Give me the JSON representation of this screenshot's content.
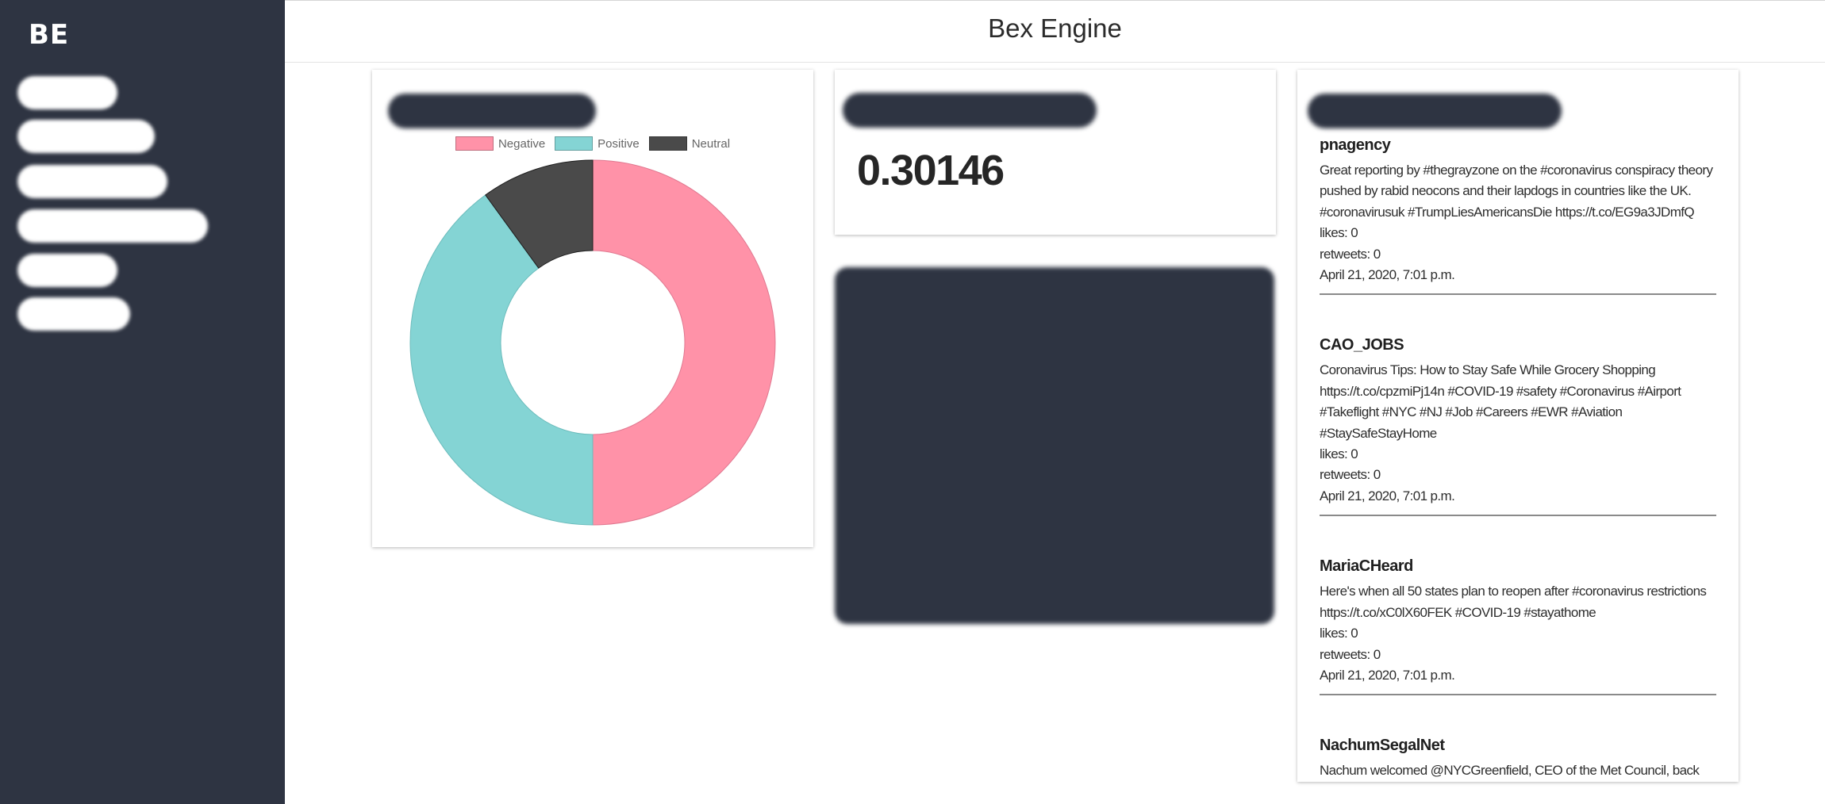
{
  "app": {
    "brand": "BE",
    "title": "Bex Engine"
  },
  "colors": {
    "sidebar": "#2e3442",
    "negative": "#ff92a8",
    "positive": "#84d4d4",
    "neutral": "#4a4a4a"
  },
  "score": {
    "value": "0.30146"
  },
  "chart_data": {
    "type": "pie",
    "variant": "doughnut",
    "categories": [
      "Negative",
      "Positive",
      "Neutral"
    ],
    "values": [
      50,
      40,
      10
    ],
    "colors": [
      "#ff92a8",
      "#84d4d4",
      "#4a4a4a"
    ],
    "legend_position": "top"
  },
  "tweets": {
    "items": [
      {
        "user": "pnagency",
        "text": "Great reporting by #thegrayzone on the #coronavirus conspiracy theory pushed by rabid neocons and their lapdogs in countries like the UK. #coronavirusuk #TrumpLiesAmericansDie https://t.co/EG9a3JDmfQ",
        "likes": "likes: 0",
        "retweets": "retweets: 0",
        "date": "April 21, 2020, 7:01 p.m."
      },
      {
        "user": "CAO_JOBS",
        "text": "Coronavirus Tips: How to Stay Safe While Grocery Shopping https://t.co/cpzmiPj14n #COVID-19 #safety #Coronavirus #Airport #Takeflight #NYC #NJ #Job #Careers #EWR #Aviation #StaySafeStayHome",
        "likes": "likes: 0",
        "retweets": "retweets: 0",
        "date": "April 21, 2020, 7:01 p.m."
      },
      {
        "user": "MariaCHeard",
        "text": "Here's when all 50 states plan to reopen after #coronavirus restrictions https://t.co/xC0lX60FEK #COVID-19 #stayathome",
        "likes": "likes: 0",
        "retweets": "retweets: 0",
        "date": "April 21, 2020, 7:01 p.m."
      },
      {
        "user": "NachumSegalNet",
        "text": "Nachum welcomed @NYCGreenfield, CEO of the Met Council, back",
        "likes": "",
        "retweets": "",
        "date": ""
      }
    ]
  }
}
